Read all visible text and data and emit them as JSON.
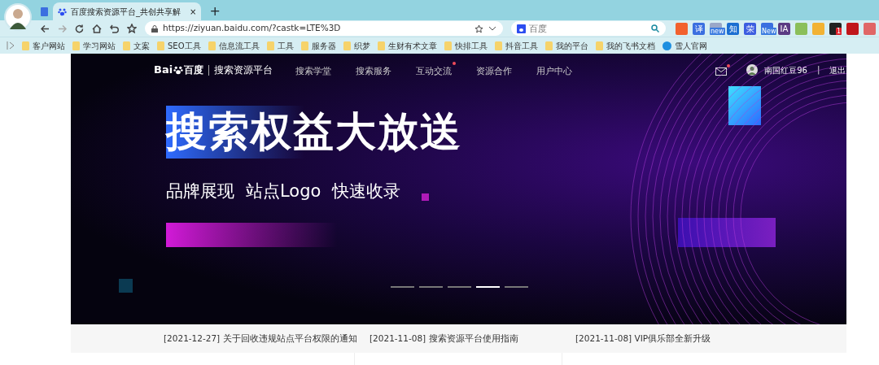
{
  "browser": {
    "tabs": [
      {
        "kind": "doc",
        "selected": false
      },
      {
        "kind": "baidu",
        "title": "百度搜索资源平台_共创共享解",
        "close": "×",
        "selected": true
      }
    ],
    "new_tab": "+",
    "address": "https://ziyuan.baidu.com/?castk=LTE%3D",
    "search": {
      "placeholder": "百度"
    },
    "extensions": [
      {
        "color": "#f2612e"
      },
      {
        "label": "译",
        "color": "#3b6fe0"
      },
      {
        "badge": "new",
        "color": "#9aa7c8"
      },
      {
        "label": "知",
        "color": "#1b6ed1"
      },
      {
        "label": "荣",
        "color": "#3c5de0"
      },
      {
        "badge": "New",
        "color": "#3b6fe0"
      },
      {
        "label": "IA",
        "color": "#5b3a83"
      },
      {
        "color": "#8bbf5a"
      },
      {
        "color": "#f2b233"
      },
      {
        "badge": "1",
        "color": "#222222"
      },
      {
        "color": "#c0161b"
      },
      {
        "color": "#e06666"
      }
    ],
    "bookmarks": [
      {
        "kind": "folder",
        "label": "客户网站"
      },
      {
        "kind": "folder",
        "label": "学习网站"
      },
      {
        "kind": "folder",
        "label": "文案"
      },
      {
        "kind": "folder",
        "label": "SEO工具"
      },
      {
        "kind": "folder",
        "label": "信息流工具"
      },
      {
        "kind": "folder",
        "label": "工具"
      },
      {
        "kind": "folder",
        "label": "服务器"
      },
      {
        "kind": "folder",
        "label": "织梦"
      },
      {
        "kind": "folder",
        "label": "生财有术文章"
      },
      {
        "kind": "folder",
        "label": "快排工具"
      },
      {
        "kind": "folder",
        "label": "抖音工具"
      },
      {
        "kind": "folder",
        "label": "我的平台"
      },
      {
        "kind": "folder",
        "label": "我的飞书文档"
      },
      {
        "kind": "site",
        "label": "雪人官网"
      }
    ]
  },
  "site": {
    "logo_part_1": "Bai",
    "logo_part_2": "百度",
    "platform": "搜索资源平台",
    "nav": [
      {
        "label": "搜索学堂",
        "dot": false
      },
      {
        "label": "搜索服务",
        "dot": false
      },
      {
        "label": "互动交流",
        "dot": true
      },
      {
        "label": "资源合作",
        "dot": false
      },
      {
        "label": "用户中心",
        "dot": false
      }
    ],
    "mail_dot": true,
    "username": "南国红豆96",
    "separator": "|",
    "logout": "退出"
  },
  "banner": {
    "headline": "搜索权益大放送",
    "subline": [
      "品牌展现",
      "站点Logo",
      "快速收录"
    ],
    "slides": [
      {
        "selected": false
      },
      {
        "selected": false
      },
      {
        "selected": false
      },
      {
        "selected": true
      },
      {
        "selected": false
      }
    ]
  },
  "news": [
    "[2021-12-27] 关于回收违规站点平台权限的通知",
    "[2021-11-08] 搜索资源平台使用指南",
    "[2021-11-08] VIP俱乐部全新升级"
  ]
}
